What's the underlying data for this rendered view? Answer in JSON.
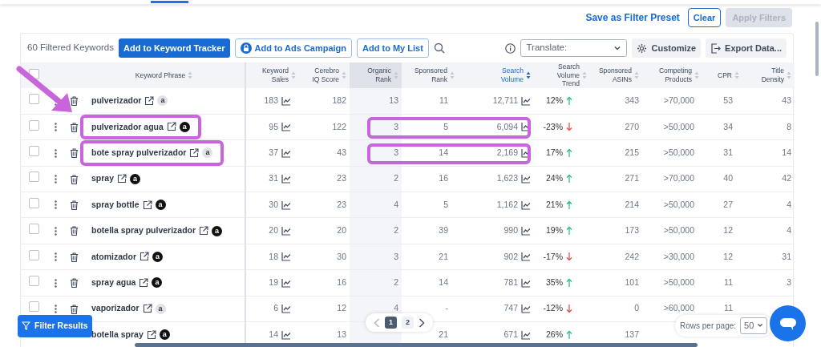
{
  "top_actions": {
    "save_preset": "Save as Filter Preset",
    "clear": "Clear",
    "apply": "Apply Filters",
    "apply_disabled": true
  },
  "toolbar": {
    "count": "60 Filtered Keywords",
    "tracker": "Add to Keyword Tracker",
    "ads": "Add to Ads Campaign",
    "list": "Add to My List",
    "translate": "Translate:",
    "customize": "Customize",
    "export": "Export Data..."
  },
  "table": {
    "header_checked": false,
    "columns": [
      {
        "label": "Keyword Phrase",
        "sorted": false,
        "shaded": false
      },
      {
        "label": "Keyword Sales",
        "sorted": false,
        "shaded": false
      },
      {
        "label": "Cerebro IQ Score",
        "sorted": false,
        "shaded": false
      },
      {
        "label": "Organic Rank",
        "sorted": false,
        "shaded": true
      },
      {
        "label": "Sponsored Rank",
        "sorted": false,
        "shaded": false
      },
      {
        "label": "Search Volume",
        "sorted": true,
        "shaded": false
      },
      {
        "label": "Search Volume Trend",
        "sorted": false,
        "shaded": false
      },
      {
        "label": "Sponsored ASINs",
        "sorted": false,
        "shaded": false
      },
      {
        "label": "Competing Products",
        "sorted": false,
        "shaded": false
      },
      {
        "label": "CPR",
        "sorted": false,
        "shaded": false
      },
      {
        "label": "Title Density",
        "sorted": false,
        "shaded": false
      }
    ],
    "rows": [
      {
        "checked": false,
        "badge": "a",
        "badge_dark": false,
        "highlighted": false,
        "trend_up": true,
        "cells": [
          "pulverizador",
          "183",
          "182",
          "13",
          "11",
          "12,711",
          "12%",
          "343",
          ">70,000",
          "53",
          "43"
        ]
      },
      {
        "checked": false,
        "badge": "a",
        "badge_dark": true,
        "highlighted": true,
        "trend_up": false,
        "cells": [
          "pulverizador agua",
          "95",
          "122",
          "3",
          "5",
          "6,094",
          "-23%",
          "270",
          ">50,000",
          "34",
          "8"
        ]
      },
      {
        "checked": false,
        "badge": "a",
        "badge_dark": false,
        "highlighted": true,
        "trend_up": true,
        "cells": [
          "bote spray pulverizador",
          "37",
          "43",
          "3",
          "14",
          "2,169",
          "17%",
          "215",
          ">50,000",
          "31",
          "14"
        ]
      },
      {
        "checked": false,
        "badge": "a",
        "badge_dark": true,
        "highlighted": false,
        "trend_up": true,
        "cells": [
          "spray",
          "31",
          "23",
          "2",
          "16",
          "1,623",
          "24%",
          "271",
          ">70,000",
          "40",
          "42"
        ]
      },
      {
        "checked": false,
        "badge": "a",
        "badge_dark": true,
        "highlighted": false,
        "trend_up": true,
        "cells": [
          "spray bottle",
          "30",
          "23",
          "4",
          "5",
          "1,162",
          "21%",
          "214",
          ">50,000",
          "27",
          "4"
        ]
      },
      {
        "checked": false,
        "badge": "a",
        "badge_dark": true,
        "highlighted": false,
        "trend_up": true,
        "cells": [
          "botella spray pulverizador",
          "20",
          "20",
          "2",
          "39",
          "990",
          "19%",
          "173",
          ">50,000",
          "12",
          "4"
        ]
      },
      {
        "checked": false,
        "badge": "a",
        "badge_dark": true,
        "highlighted": false,
        "trend_up": false,
        "cells": [
          "atomizador",
          "18",
          "30",
          "3",
          "21",
          "902",
          "-17%",
          "242",
          ">30,000",
          "12",
          "31"
        ]
      },
      {
        "checked": false,
        "badge": "a",
        "badge_dark": true,
        "highlighted": false,
        "trend_up": true,
        "cells": [
          "spray agua",
          "19",
          "16",
          "2",
          "14",
          "781",
          "35%",
          "101",
          ">50,000",
          "11",
          "3"
        ]
      },
      {
        "checked": false,
        "badge": "a",
        "badge_dark": false,
        "highlighted": false,
        "trend_up": false,
        "cells": [
          "vaporizador",
          "6",
          "12",
          "4",
          "-",
          "747",
          "-12%",
          "0",
          ">60,000",
          "11",
          ""
        ]
      },
      {
        "badge": "a",
        "badge_dark": true,
        "highlighted": false,
        "trend_up": true,
        "cells": [
          "botella spray",
          "14",
          "13",
          "",
          "21",
          "671",
          "26%",
          "137",
          "",
          "",
          ""
        ]
      }
    ]
  },
  "filter_button": "Filter Results",
  "pagination": [
    {
      "label": "1",
      "selected": true
    },
    {
      "label": "2",
      "selected": false
    }
  ],
  "rows_per_page": {
    "label": "Rows per page:",
    "value": "50"
  }
}
